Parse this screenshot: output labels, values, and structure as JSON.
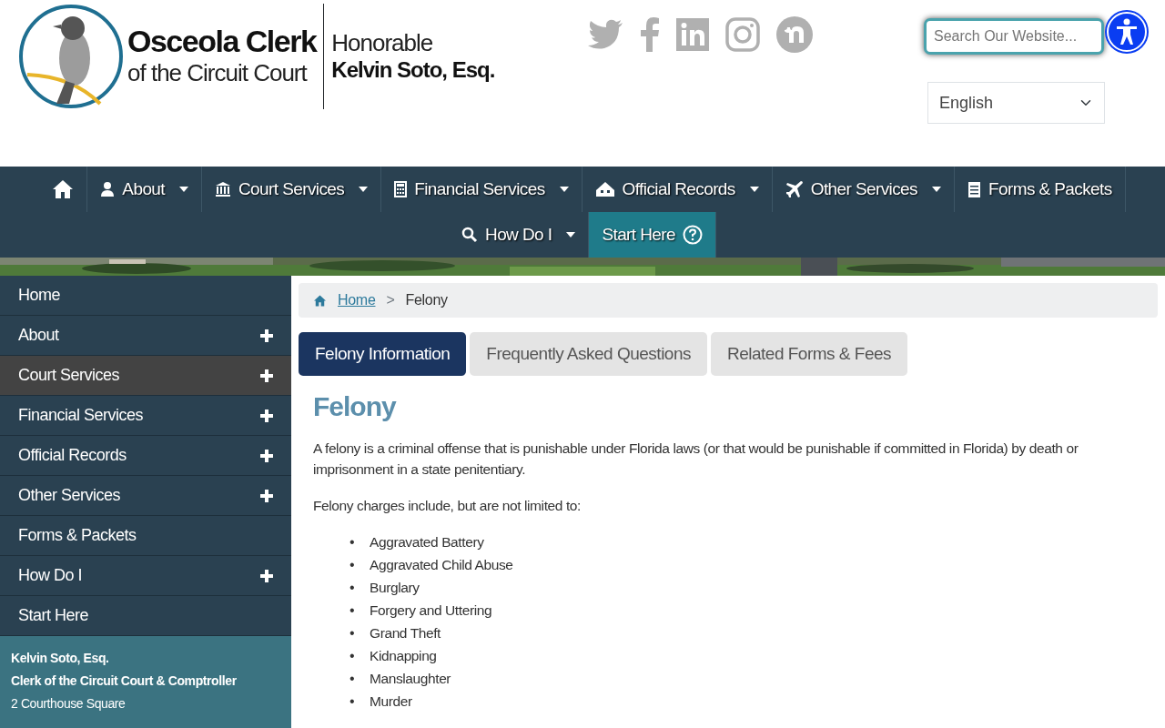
{
  "header": {
    "logo": {
      "line_1": "Osceola Clerk",
      "line_2": "of the Circuit Court",
      "line_3": "Honorable",
      "line_4": "Kelvin Soto, Esq."
    },
    "social": [
      {
        "kind": "twitter"
      },
      {
        "kind": "facebook"
      },
      {
        "kind": "linkedin"
      },
      {
        "kind": "instagram"
      },
      {
        "kind": "nextdoor"
      }
    ],
    "search": {
      "placeholder": "Search Our Website..."
    },
    "language": {
      "value": "English"
    }
  },
  "nav": [
    {
      "kind": "home",
      "caret": false,
      "selected": false
    },
    {
      "kind": "person",
      "label": "About",
      "caret": true,
      "selected": false
    },
    {
      "kind": "bank",
      "label": "Court Services",
      "caret": true,
      "selected": false
    },
    {
      "kind": "calculator",
      "label": "Financial Services",
      "caret": true,
      "selected": false
    },
    {
      "kind": "houses",
      "label": "Official Records",
      "caret": true,
      "selected": false
    },
    {
      "kind": "plane",
      "label": "Other Services",
      "caret": true,
      "selected": false
    },
    {
      "kind": "document",
      "label": "Forms & Packets",
      "caret": false,
      "selected": false
    },
    {
      "kind": "search",
      "label": "How Do I",
      "caret": true,
      "selected": false
    },
    {
      "kind": "help",
      "label": "Start Here",
      "caret": false,
      "selected": true
    }
  ],
  "sidebar": {
    "items": [
      {
        "label": "Home",
        "expandable": false,
        "selected": false
      },
      {
        "label": "About",
        "expandable": true,
        "selected": false
      },
      {
        "label": "Court Services",
        "expandable": true,
        "selected": true
      },
      {
        "label": "Financial Services",
        "expandable": true,
        "selected": false
      },
      {
        "label": "Official Records",
        "expandable": true,
        "selected": false
      },
      {
        "label": "Other Services",
        "expandable": true,
        "selected": false
      },
      {
        "label": "Forms & Packets",
        "expandable": false,
        "selected": false
      },
      {
        "label": "How Do I",
        "expandable": true,
        "selected": false
      },
      {
        "label": "Start Here",
        "expandable": false,
        "selected": false
      }
    ],
    "contact": [
      "Kelvin Soto, Esq.",
      "Clerk of the Circuit Court & Comptroller",
      "2 Courthouse Square"
    ]
  },
  "breadcrumb": {
    "separator": ">",
    "items": [
      {
        "label": "Home",
        "link": true
      },
      {
        "label": "Felony",
        "link": false
      }
    ]
  },
  "tabs": [
    {
      "label": "Felony Information",
      "selected": true
    },
    {
      "label": "Frequently Asked Questions",
      "selected": false
    },
    {
      "label": "Related Forms & Fees",
      "selected": false
    }
  ],
  "content": {
    "title": "Felony",
    "paragraphs": [
      "A felony is a criminal offense that is punishable under Florida laws (or that would be punishable if committed in Florida) by death or imprisonment in a state penitentiary.",
      "Felony charges include, but are not limited to:"
    ],
    "bullet": "•",
    "list": [
      "Aggravated Battery",
      "Aggravated Child Abuse",
      "Burglary",
      "Forgery and Uttering",
      "Grand Theft",
      "Kidnapping",
      "Manslaughter",
      "Murder"
    ]
  }
}
